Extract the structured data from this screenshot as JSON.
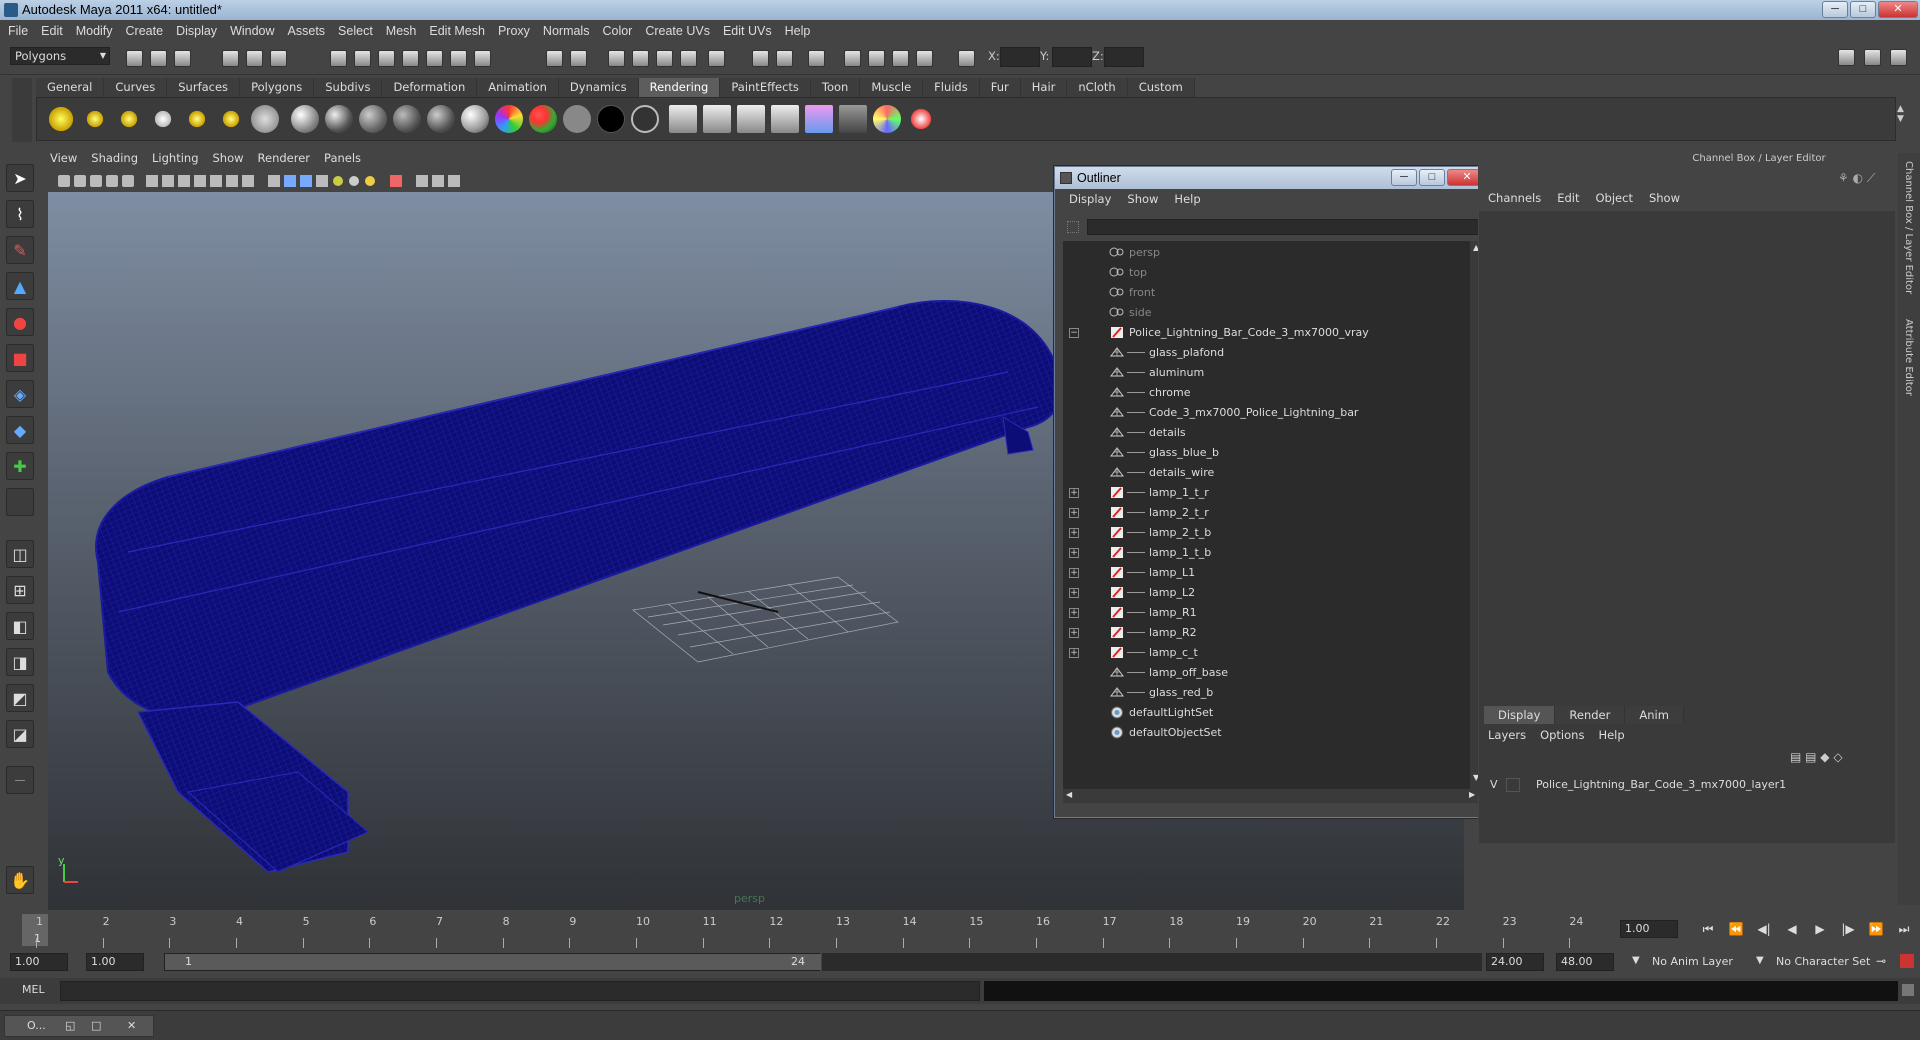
{
  "window": {
    "title": "Autodesk Maya 2011 x64: untitled*"
  },
  "menubar": [
    "File",
    "Edit",
    "Modify",
    "Create",
    "Display",
    "Window",
    "Assets",
    "Select",
    "Mesh",
    "Edit Mesh",
    "Proxy",
    "Normals",
    "Color",
    "Create UVs",
    "Edit UVs",
    "Help"
  ],
  "status": {
    "mode": "Polygons",
    "x_label": "X:",
    "y_label": "Y:",
    "z_label": "Z:"
  },
  "shelf": {
    "tabs": [
      "General",
      "Curves",
      "Surfaces",
      "Polygons",
      "Subdivs",
      "Deformation",
      "Animation",
      "Dynamics",
      "Rendering",
      "PaintEffects",
      "Toon",
      "Muscle",
      "Fluids",
      "Fur",
      "Hair",
      "nCloth",
      "Custom"
    ],
    "active": "Rendering"
  },
  "viewport": {
    "menu": [
      "View",
      "Shading",
      "Lighting",
      "Show",
      "Renderer",
      "Panels"
    ],
    "camera_label": "persp",
    "axis_y": "y",
    "axis_x": "x"
  },
  "outliner": {
    "title": "Outliner",
    "menu": [
      "Display",
      "Show",
      "Help"
    ],
    "items": [
      {
        "label": "persp",
        "type": "camera",
        "dim": true
      },
      {
        "label": "top",
        "type": "camera",
        "dim": true
      },
      {
        "label": "front",
        "type": "camera",
        "dim": true
      },
      {
        "label": "side",
        "type": "camera",
        "dim": true
      },
      {
        "label": "Police_Lightning_Bar_Code_3_mx7000_vray",
        "type": "group",
        "expander": "−"
      },
      {
        "label": "glass_plafond",
        "type": "mesh",
        "child": true
      },
      {
        "label": "aluminum",
        "type": "mesh",
        "child": true
      },
      {
        "label": "chrome",
        "type": "mesh",
        "child": true
      },
      {
        "label": "Code_3_mx7000_Police_Lightning_bar",
        "type": "mesh",
        "child": true
      },
      {
        "label": "details",
        "type": "mesh",
        "child": true
      },
      {
        "label": "glass_blue_b",
        "type": "mesh",
        "child": true
      },
      {
        "label": "details_wire",
        "type": "mesh",
        "child": true
      },
      {
        "label": "lamp_1_t_r",
        "type": "group",
        "child": true,
        "expander": "+"
      },
      {
        "label": "lamp_2_t_r",
        "type": "group",
        "child": true,
        "expander": "+"
      },
      {
        "label": "lamp_2_t_b",
        "type": "group",
        "child": true,
        "expander": "+"
      },
      {
        "label": "lamp_1_t_b",
        "type": "group",
        "child": true,
        "expander": "+"
      },
      {
        "label": "lamp_L1",
        "type": "group",
        "child": true,
        "expander": "+"
      },
      {
        "label": "lamp_L2",
        "type": "group",
        "child": true,
        "expander": "+"
      },
      {
        "label": "lamp_R1",
        "type": "group",
        "child": true,
        "expander": "+"
      },
      {
        "label": "lamp_R2",
        "type": "group",
        "child": true,
        "expander": "+"
      },
      {
        "label": "lamp_c_t",
        "type": "group",
        "child": true,
        "expander": "+"
      },
      {
        "label": "lamp_off_base",
        "type": "mesh",
        "child": true
      },
      {
        "label": "glass_red_b",
        "type": "mesh",
        "child": true
      },
      {
        "label": "defaultLightSet",
        "type": "set"
      },
      {
        "label": "defaultObjectSet",
        "type": "set"
      }
    ]
  },
  "channelbox": {
    "header": "Channel Box / Layer Editor",
    "menu": [
      "Channels",
      "Edit",
      "Object",
      "Show"
    ],
    "layer_tabs": [
      "Display",
      "Render",
      "Anim"
    ],
    "active_layer_tab": "Display",
    "layer_menu": [
      "Layers",
      "Options",
      "Help"
    ],
    "layer_visibility": "V",
    "layer_name": "Police_Lightning_Bar_Code_3_mx7000_layer1"
  },
  "side_tabs": [
    "Channel Box / Layer Editor",
    "Attribute Editor"
  ],
  "timeslider": {
    "ticks": [
      "1",
      "2",
      "3",
      "4",
      "5",
      "6",
      "7",
      "8",
      "9",
      "10",
      "11",
      "12",
      "13",
      "14",
      "15",
      "16",
      "17",
      "18",
      "19",
      "20",
      "21",
      "22",
      "23",
      "24"
    ],
    "current_frame": "1",
    "current_frame_field": "1.00"
  },
  "range": {
    "start": "1.00",
    "playback_start": "1.00",
    "slider_start": "1",
    "slider_end": "24",
    "playback_end": "24.00",
    "end": "48.00",
    "anim_layer": "No Anim Layer",
    "character_set": "No Character Set"
  },
  "cmdline": {
    "label": "MEL"
  },
  "taskbar": {
    "item": "O..."
  },
  "colors": {
    "mesh": "#0d0d78",
    "mesh_wire": "#2a2ab8",
    "viewport_top": "#7f8ea3",
    "viewport_bottom": "#2f3236"
  }
}
